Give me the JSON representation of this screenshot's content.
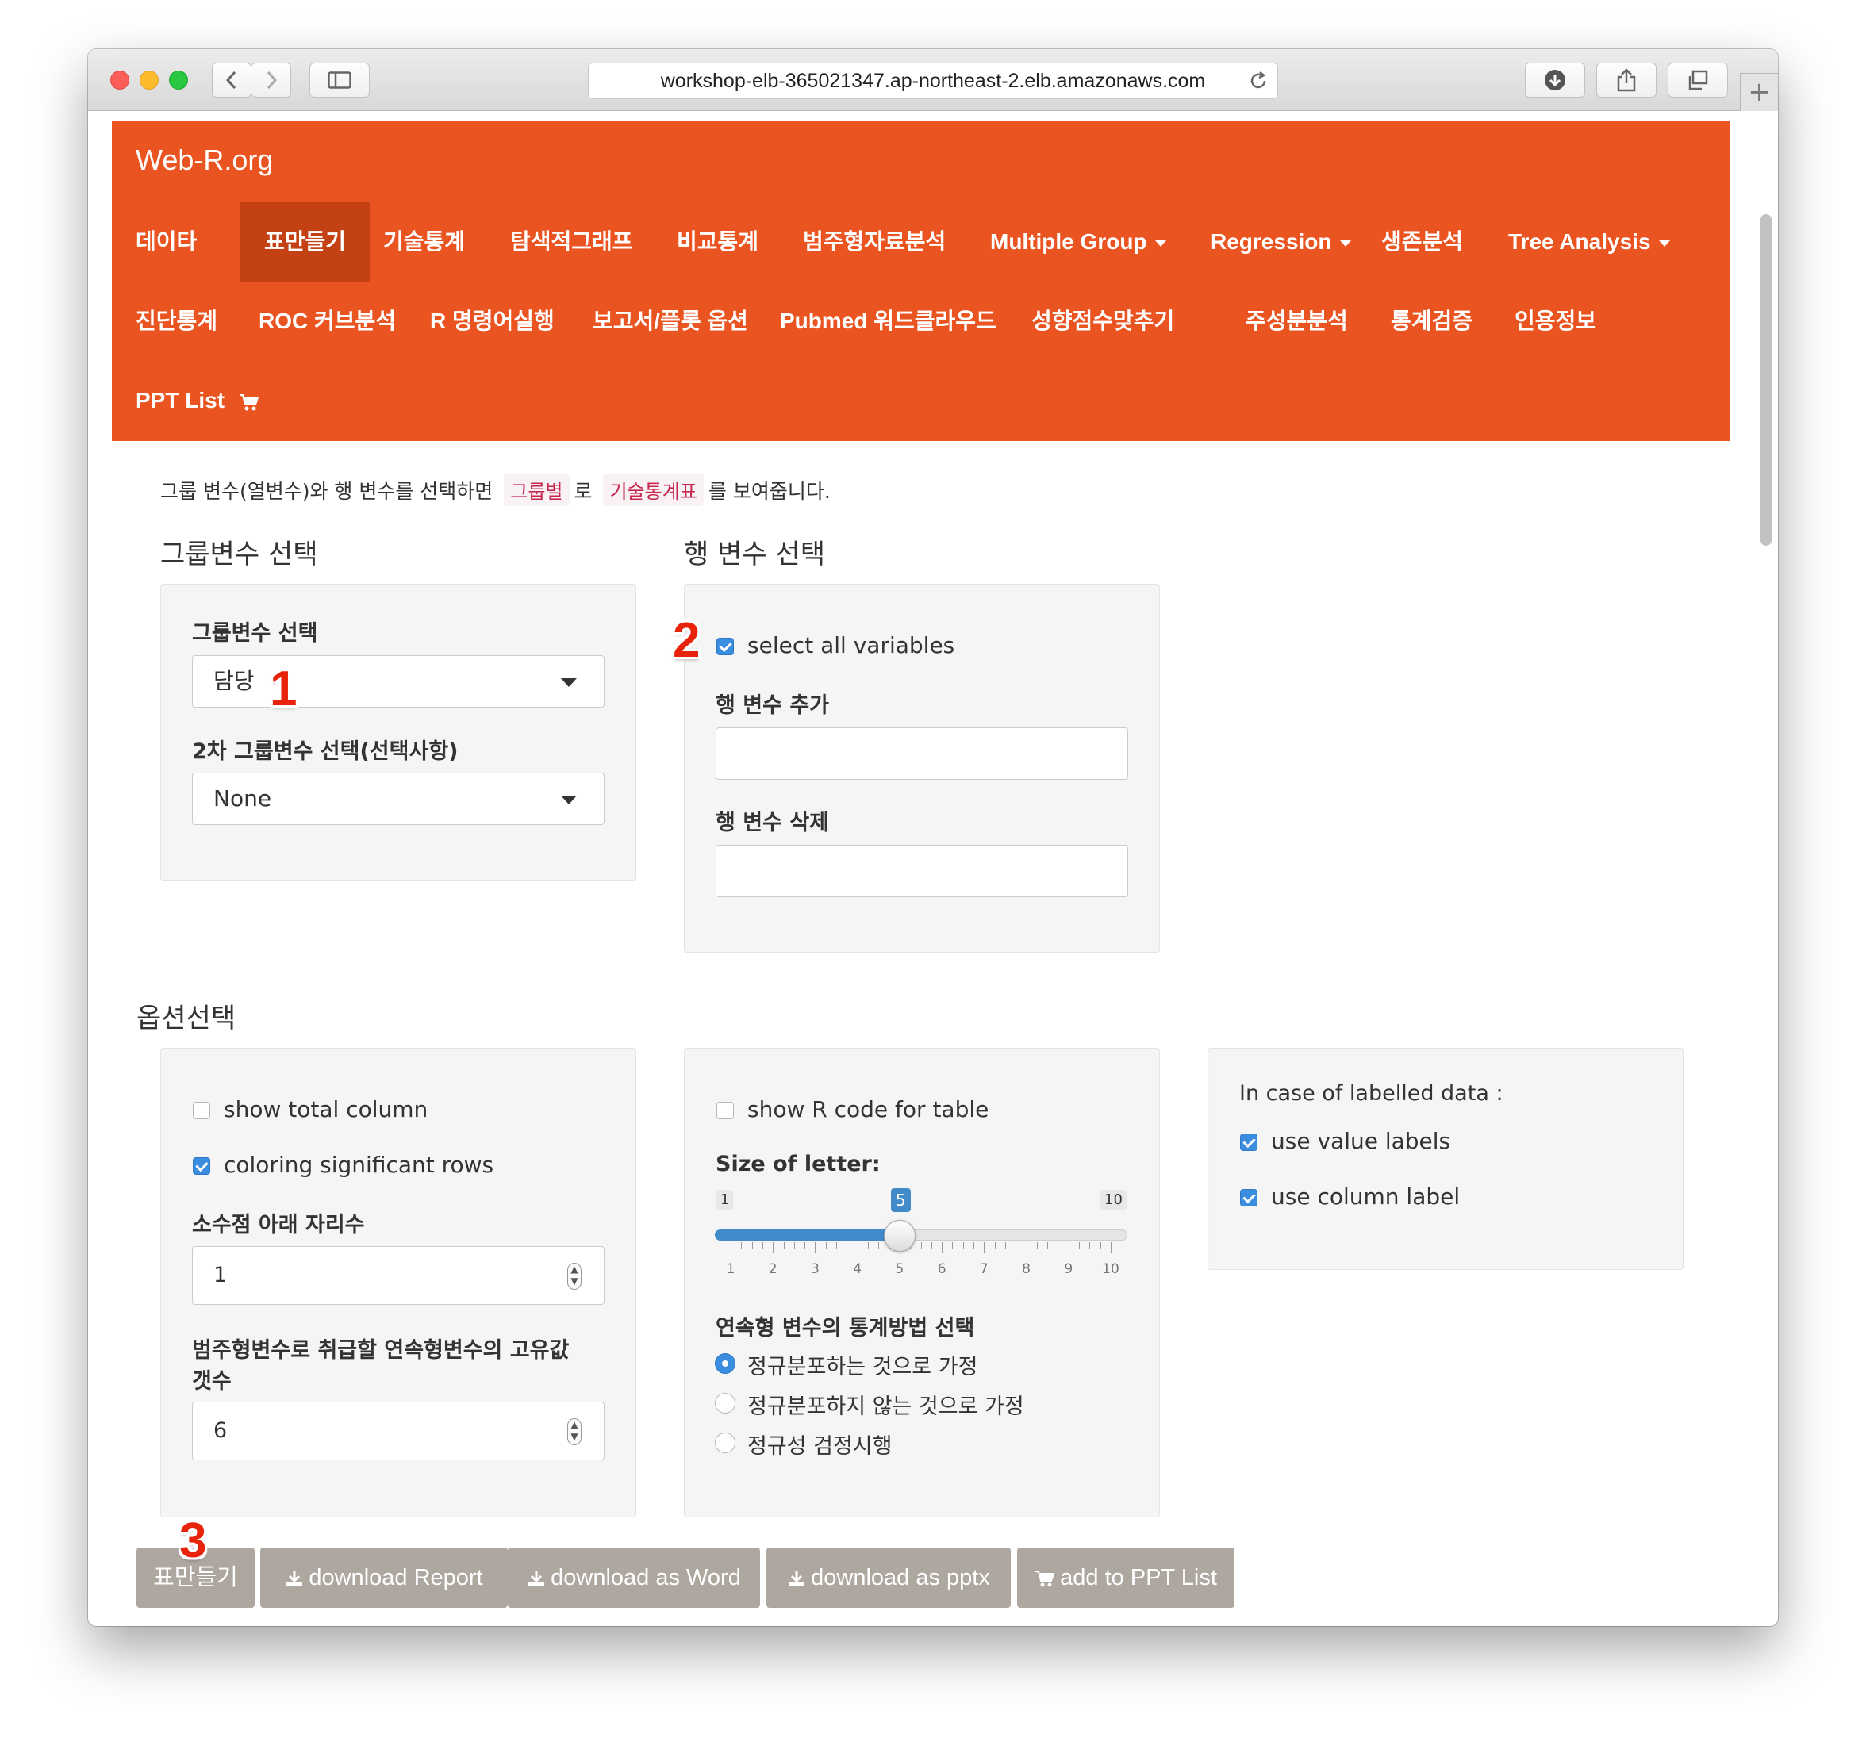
{
  "browser": {
    "url": "workshop-elb-365021347.ap-northeast-2.elb.amazonaws.com",
    "newtab_label": "+"
  },
  "navbar": {
    "brand": "Web-R.org",
    "items": [
      {
        "label": "데이타"
      },
      {
        "label": "표만들기",
        "active": true
      },
      {
        "label": "기술통계"
      },
      {
        "label": "탐색적그래프"
      },
      {
        "label": "비교통계"
      },
      {
        "label": "범주형자료분석"
      },
      {
        "label": "Multiple Group",
        "dropdown": true
      },
      {
        "label": "Regression",
        "dropdown": true
      },
      {
        "label": "생존분석"
      },
      {
        "label": "Tree Analysis",
        "dropdown": true
      },
      {
        "label": "진단통계"
      },
      {
        "label": "ROC 커브분석"
      },
      {
        "label": "R 명령어실행"
      },
      {
        "label": "보고서/플롯 옵션"
      },
      {
        "label": "Pubmed 워드클라우드"
      },
      {
        "label": "성향점수맞추기"
      },
      {
        "label": "주성분분석"
      },
      {
        "label": "통계검증"
      },
      {
        "label": "인용정보"
      },
      {
        "label": "PPT List"
      }
    ],
    "accent_color": "#e95420",
    "active_color": "#c34113"
  },
  "intro": {
    "part1": "그룹 변수(열변수)와 행 변수를 선택하면",
    "code1": "그룹별",
    "part2": "로",
    "code2": "기술통계표",
    "part3": "를 보여줍니다."
  },
  "group_section": {
    "heading": "그룹변수 선택",
    "group_var_label": "그룹변수 선택",
    "group_var_value": "담당",
    "second_group_label": "2차 그룹변수 선택(선택사항)",
    "second_group_value": "None"
  },
  "row_section": {
    "heading": "행 변수 선택",
    "select_all_label": "select all variables",
    "select_all_checked": true,
    "add_label": "행 변수 추가",
    "add_value": "",
    "remove_label": "행 변수 삭제",
    "remove_value": ""
  },
  "options": {
    "heading": "옵션선택",
    "show_total_label": "show total column",
    "show_total_checked": false,
    "coloring_label": "coloring significant rows",
    "coloring_checked": true,
    "decimal_label": "소수점 아래 자리수",
    "decimal_value": "1",
    "unique_label_line1": "범주형변수로 취급할 연속형변수의 고유값",
    "unique_label_line2": "갯수",
    "unique_value": "6",
    "show_rcode_label": "show R code for table",
    "show_rcode_checked": false,
    "size_label": "Size of letter:",
    "size_min": 1,
    "size_max": 10,
    "size_value": 5,
    "tick_labels": [
      "1",
      "2",
      "3",
      "4",
      "5",
      "6",
      "7",
      "8",
      "9",
      "10"
    ],
    "method_label": "연속형 변수의 통계방법 선택",
    "methods": [
      "정규분포하는 것으로 가정",
      "정규분포하지 않는 것으로 가정",
      "정규성 검정시행"
    ],
    "method_selected": 0,
    "labelled_heading": "In case of labelled data :",
    "value_labels_label": "use value labels",
    "value_labels_checked": true,
    "column_label_label": "use column label",
    "column_label_checked": true
  },
  "buttons": {
    "make_table": "표만들기",
    "download_report": "download Report",
    "download_word": "download as Word",
    "download_pptx": "download as pptx",
    "add_ppt": "add to PPT List",
    "color": "#aea79f"
  },
  "annotations": {
    "one": "1",
    "two": "2",
    "three": "3",
    "color": "#e8230b"
  }
}
